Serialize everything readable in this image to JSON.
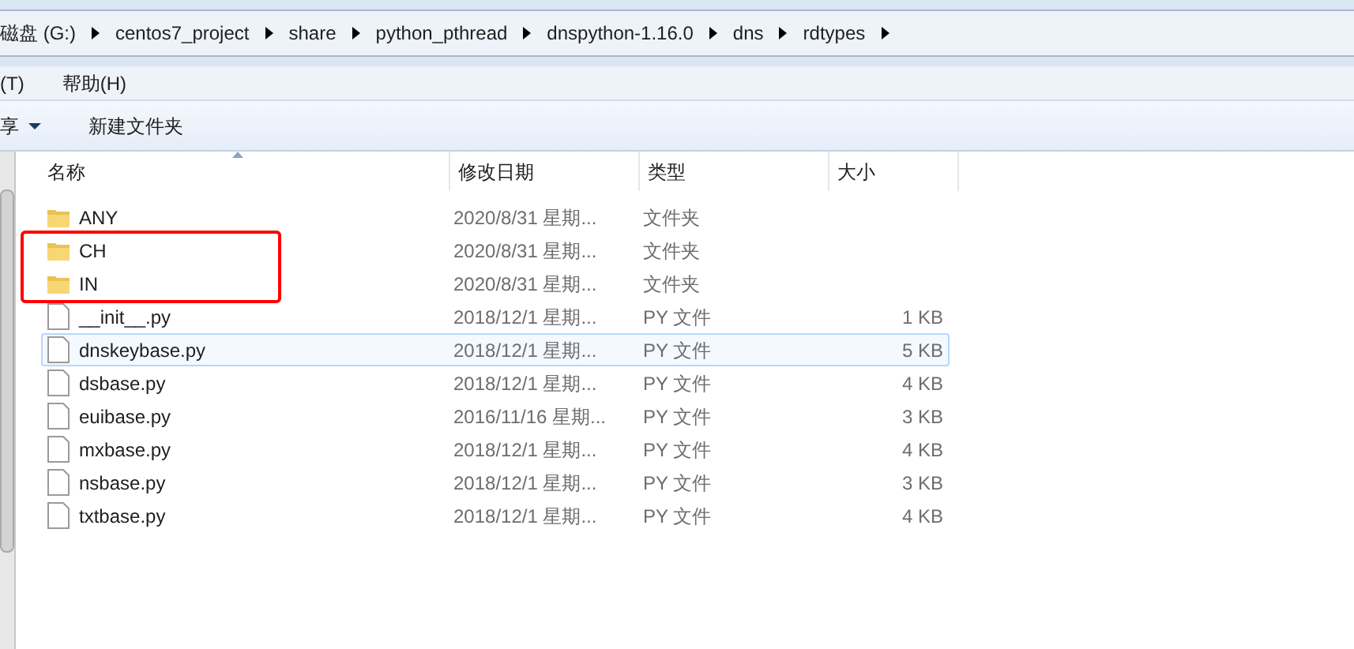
{
  "address_bar": {
    "segments": [
      "磁盘 (G:)",
      "centos7_project",
      "share",
      "python_pthread",
      "dnspython-1.16.0",
      "dns",
      "rdtypes"
    ]
  },
  "menu_bar": [
    "(T)",
    "帮助(H)"
  ],
  "toolbar": [
    {
      "label": "享",
      "kind": "dropdown"
    },
    {
      "label": "新建文件夹",
      "kind": "button"
    }
  ],
  "table": {
    "columns": [
      {
        "label": "名称",
        "sorted": true
      },
      {
        "label": "修改日期",
        "sorted": false
      },
      {
        "label": "类型",
        "sorted": false
      },
      {
        "label": "大小",
        "sorted": false
      }
    ],
    "rows": [
      {
        "kind": "folder",
        "name": "ANY",
        "date": "2020/8/31 星期...",
        "type": "文件夹",
        "size": "",
        "selected": false,
        "marked": false
      },
      {
        "kind": "folder",
        "name": "CH",
        "date": "2020/8/31 星期...",
        "type": "文件夹",
        "size": "",
        "selected": false,
        "marked": true
      },
      {
        "kind": "folder",
        "name": "IN",
        "date": "2020/8/31 星期...",
        "type": "文件夹",
        "size": "",
        "selected": false,
        "marked": true
      },
      {
        "kind": "file",
        "name": "__init__.py",
        "date": "2018/12/1 星期...",
        "type": "PY 文件",
        "size": "1 KB",
        "selected": false,
        "marked": false
      },
      {
        "kind": "file",
        "name": "dnskeybase.py",
        "date": "2018/12/1 星期...",
        "type": "PY 文件",
        "size": "5 KB",
        "selected": true,
        "marked": false
      },
      {
        "kind": "file",
        "name": "dsbase.py",
        "date": "2018/12/1 星期...",
        "type": "PY 文件",
        "size": "4 KB",
        "selected": false,
        "marked": false
      },
      {
        "kind": "file",
        "name": "euibase.py",
        "date": "2016/11/16 星期...",
        "type": "PY 文件",
        "size": "3 KB",
        "selected": false,
        "marked": false
      },
      {
        "kind": "file",
        "name": "mxbase.py",
        "date": "2018/12/1 星期...",
        "type": "PY 文件",
        "size": "4 KB",
        "selected": false,
        "marked": false
      },
      {
        "kind": "file",
        "name": "nsbase.py",
        "date": "2018/12/1 星期...",
        "type": "PY 文件",
        "size": "3 KB",
        "selected": false,
        "marked": false
      },
      {
        "kind": "file",
        "name": "txtbase.py",
        "date": "2018/12/1 星期...",
        "type": "PY 文件",
        "size": "4 KB",
        "selected": false,
        "marked": false
      }
    ]
  }
}
